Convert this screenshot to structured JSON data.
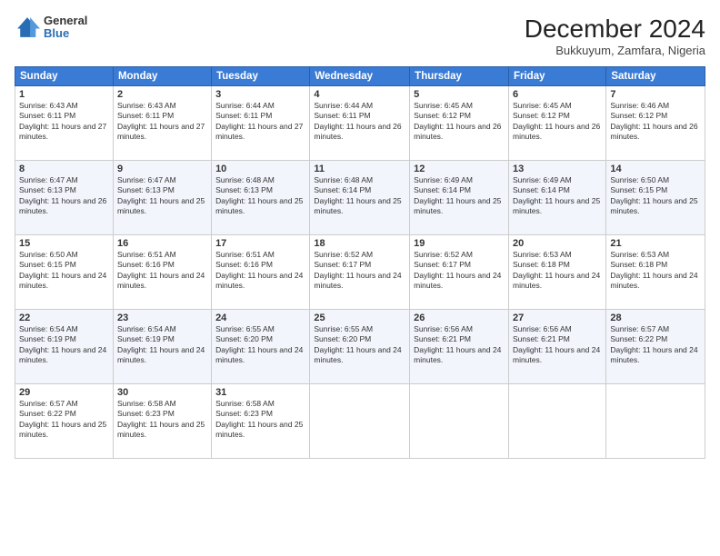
{
  "header": {
    "logo": {
      "general": "General",
      "blue": "Blue"
    },
    "title": "December 2024",
    "subtitle": "Bukkuyum, Zamfara, Nigeria"
  },
  "days_of_week": [
    "Sunday",
    "Monday",
    "Tuesday",
    "Wednesday",
    "Thursday",
    "Friday",
    "Saturday"
  ],
  "weeks": [
    [
      {
        "day": "1",
        "text": "Sunrise: 6:43 AM\nSunset: 6:11 PM\nDaylight: 11 hours and 27 minutes."
      },
      {
        "day": "2",
        "text": "Sunrise: 6:43 AM\nSunset: 6:11 PM\nDaylight: 11 hours and 27 minutes."
      },
      {
        "day": "3",
        "text": "Sunrise: 6:44 AM\nSunset: 6:11 PM\nDaylight: 11 hours and 27 minutes."
      },
      {
        "day": "4",
        "text": "Sunrise: 6:44 AM\nSunset: 6:11 PM\nDaylight: 11 hours and 26 minutes."
      },
      {
        "day": "5",
        "text": "Sunrise: 6:45 AM\nSunset: 6:12 PM\nDaylight: 11 hours and 26 minutes."
      },
      {
        "day": "6",
        "text": "Sunrise: 6:45 AM\nSunset: 6:12 PM\nDaylight: 11 hours and 26 minutes."
      },
      {
        "day": "7",
        "text": "Sunrise: 6:46 AM\nSunset: 6:12 PM\nDaylight: 11 hours and 26 minutes."
      }
    ],
    [
      {
        "day": "8",
        "text": "Sunrise: 6:47 AM\nSunset: 6:13 PM\nDaylight: 11 hours and 26 minutes."
      },
      {
        "day": "9",
        "text": "Sunrise: 6:47 AM\nSunset: 6:13 PM\nDaylight: 11 hours and 25 minutes."
      },
      {
        "day": "10",
        "text": "Sunrise: 6:48 AM\nSunset: 6:13 PM\nDaylight: 11 hours and 25 minutes."
      },
      {
        "day": "11",
        "text": "Sunrise: 6:48 AM\nSunset: 6:14 PM\nDaylight: 11 hours and 25 minutes."
      },
      {
        "day": "12",
        "text": "Sunrise: 6:49 AM\nSunset: 6:14 PM\nDaylight: 11 hours and 25 minutes."
      },
      {
        "day": "13",
        "text": "Sunrise: 6:49 AM\nSunset: 6:14 PM\nDaylight: 11 hours and 25 minutes."
      },
      {
        "day": "14",
        "text": "Sunrise: 6:50 AM\nSunset: 6:15 PM\nDaylight: 11 hours and 25 minutes."
      }
    ],
    [
      {
        "day": "15",
        "text": "Sunrise: 6:50 AM\nSunset: 6:15 PM\nDaylight: 11 hours and 24 minutes."
      },
      {
        "day": "16",
        "text": "Sunrise: 6:51 AM\nSunset: 6:16 PM\nDaylight: 11 hours and 24 minutes."
      },
      {
        "day": "17",
        "text": "Sunrise: 6:51 AM\nSunset: 6:16 PM\nDaylight: 11 hours and 24 minutes."
      },
      {
        "day": "18",
        "text": "Sunrise: 6:52 AM\nSunset: 6:17 PM\nDaylight: 11 hours and 24 minutes."
      },
      {
        "day": "19",
        "text": "Sunrise: 6:52 AM\nSunset: 6:17 PM\nDaylight: 11 hours and 24 minutes."
      },
      {
        "day": "20",
        "text": "Sunrise: 6:53 AM\nSunset: 6:18 PM\nDaylight: 11 hours and 24 minutes."
      },
      {
        "day": "21",
        "text": "Sunrise: 6:53 AM\nSunset: 6:18 PM\nDaylight: 11 hours and 24 minutes."
      }
    ],
    [
      {
        "day": "22",
        "text": "Sunrise: 6:54 AM\nSunset: 6:19 PM\nDaylight: 11 hours and 24 minutes."
      },
      {
        "day": "23",
        "text": "Sunrise: 6:54 AM\nSunset: 6:19 PM\nDaylight: 11 hours and 24 minutes."
      },
      {
        "day": "24",
        "text": "Sunrise: 6:55 AM\nSunset: 6:20 PM\nDaylight: 11 hours and 24 minutes."
      },
      {
        "day": "25",
        "text": "Sunrise: 6:55 AM\nSunset: 6:20 PM\nDaylight: 11 hours and 24 minutes."
      },
      {
        "day": "26",
        "text": "Sunrise: 6:56 AM\nSunset: 6:21 PM\nDaylight: 11 hours and 24 minutes."
      },
      {
        "day": "27",
        "text": "Sunrise: 6:56 AM\nSunset: 6:21 PM\nDaylight: 11 hours and 24 minutes."
      },
      {
        "day": "28",
        "text": "Sunrise: 6:57 AM\nSunset: 6:22 PM\nDaylight: 11 hours and 24 minutes."
      }
    ],
    [
      {
        "day": "29",
        "text": "Sunrise: 6:57 AM\nSunset: 6:22 PM\nDaylight: 11 hours and 25 minutes."
      },
      {
        "day": "30",
        "text": "Sunrise: 6:58 AM\nSunset: 6:23 PM\nDaylight: 11 hours and 25 minutes."
      },
      {
        "day": "31",
        "text": "Sunrise: 6:58 AM\nSunset: 6:23 PM\nDaylight: 11 hours and 25 minutes."
      },
      null,
      null,
      null,
      null
    ]
  ]
}
